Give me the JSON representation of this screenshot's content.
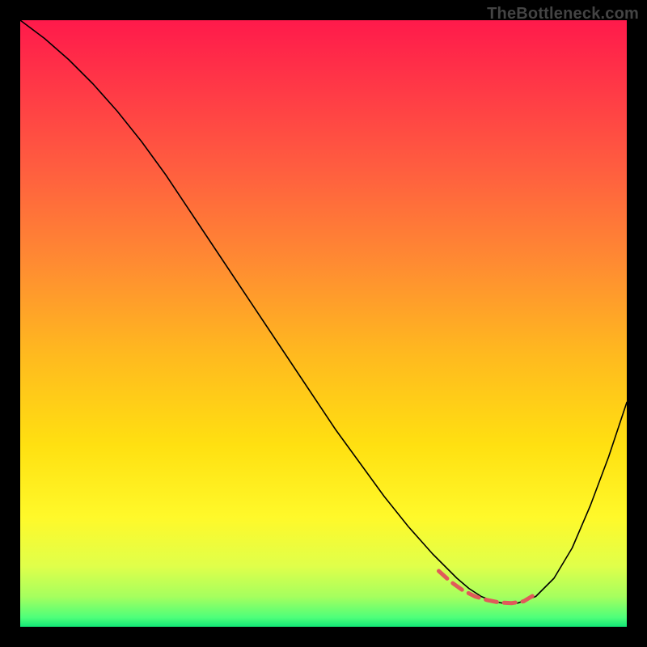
{
  "watermark": "TheBottleneck.com",
  "chart_data": {
    "type": "line",
    "title": "",
    "xlabel": "",
    "ylabel": "",
    "xlim": [
      0,
      100
    ],
    "ylim": [
      0,
      100
    ],
    "grid": false,
    "background_gradient": {
      "stops": [
        {
          "offset": 0.0,
          "color": "#ff1a4b"
        },
        {
          "offset": 0.12,
          "color": "#ff3b46"
        },
        {
          "offset": 0.25,
          "color": "#ff5f3f"
        },
        {
          "offset": 0.4,
          "color": "#ff8b32"
        },
        {
          "offset": 0.55,
          "color": "#ffb91f"
        },
        {
          "offset": 0.7,
          "color": "#ffe011"
        },
        {
          "offset": 0.82,
          "color": "#fff92a"
        },
        {
          "offset": 0.9,
          "color": "#e0ff4a"
        },
        {
          "offset": 0.95,
          "color": "#a6ff5e"
        },
        {
          "offset": 0.985,
          "color": "#4dff7a"
        },
        {
          "offset": 1.0,
          "color": "#12e676"
        }
      ]
    },
    "series": [
      {
        "name": "curve",
        "stroke": "#000000",
        "stroke_width": 1.6,
        "x": [
          0,
          4,
          8,
          12,
          16,
          20,
          24,
          28,
          32,
          36,
          40,
          44,
          48,
          52,
          56,
          60,
          64,
          68,
          70,
          72,
          74,
          76,
          78,
          80,
          82,
          85,
          88,
          91,
          94,
          97,
          100
        ],
        "y": [
          100,
          97,
          93.5,
          89.5,
          85,
          80,
          74.5,
          68.5,
          62.5,
          56.5,
          50.5,
          44.5,
          38.5,
          32.5,
          27,
          21.5,
          16.5,
          12,
          10,
          8,
          6.3,
          5,
          4.2,
          3.8,
          3.9,
          5,
          8,
          13,
          20,
          28,
          37
        ]
      },
      {
        "name": "highlight",
        "stroke": "#e05a5a",
        "stroke_width": 5,
        "dash": [
          14,
          9
        ],
        "x": [
          69,
          71,
          73,
          75,
          77,
          79,
          81,
          83,
          85
        ],
        "y": [
          9.2,
          7.4,
          6.0,
          5.0,
          4.4,
          4.0,
          3.9,
          4.2,
          5.4
        ]
      }
    ]
  }
}
